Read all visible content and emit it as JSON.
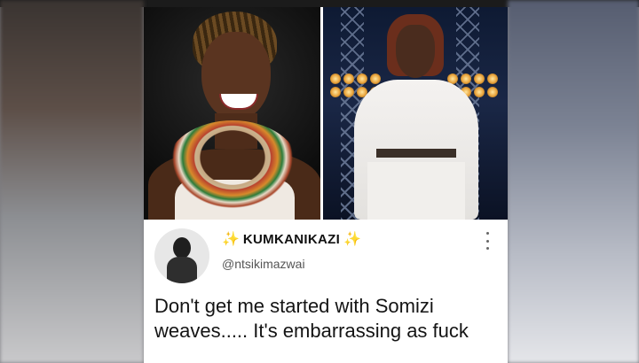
{
  "tweet": {
    "display_name": "KUMKANIKAZI",
    "handle": "@ntsikimazwai",
    "text": "Don't get me started with Somizi weaves..... It's embarrassing as fuck",
    "name_decoration_icon": "sparkles-icon",
    "menu_icon": "more-vertical-icon"
  },
  "colors": {
    "sparkle": "#f2c230",
    "text": "#141414",
    "handle": "#555555"
  }
}
